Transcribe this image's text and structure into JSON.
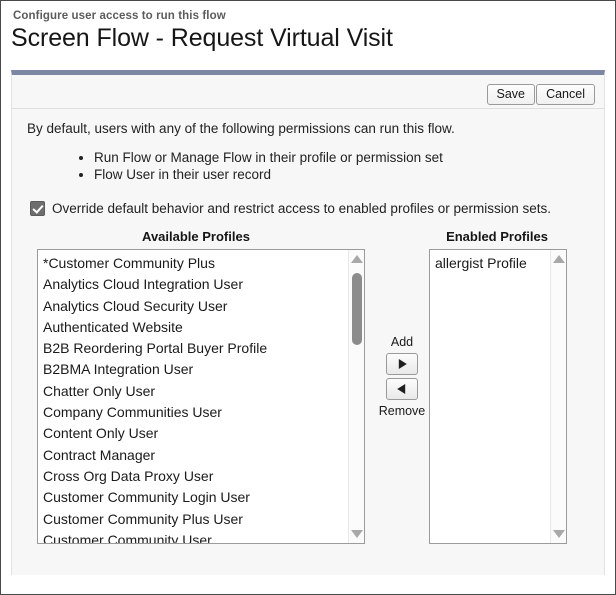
{
  "header": {
    "eyebrow": "Configure user access to run this flow",
    "title": "Screen Flow - Request Virtual Visit"
  },
  "toolbar": {
    "save_label": "Save",
    "cancel_label": "Cancel"
  },
  "body": {
    "intro": "By default, users with any of the following permissions can run this flow.",
    "permissions": [
      "Run Flow or Manage Flow in their profile or permission set",
      "Flow User in their user record"
    ],
    "override": {
      "checked": true,
      "label": "Override default behavior and restrict access to enabled profiles or permission sets."
    }
  },
  "dual_list": {
    "available": {
      "label": "Available Profiles",
      "options": [
        "*Customer Community Plus",
        "Analytics Cloud Integration User",
        "Analytics Cloud Security User",
        "Authenticated Website",
        "B2B Reordering Portal Buyer Profile",
        "B2BMA Integration User",
        "Chatter Only User",
        "Company Communities User",
        "Content Only User",
        "Contract Manager",
        "Cross Org Data Proxy User",
        "Customer Community Login User",
        "Customer Community Plus User",
        "Customer Community User"
      ]
    },
    "enabled": {
      "label": "Enabled Profiles",
      "options": [
        "allergist Profile"
      ]
    },
    "transfer": {
      "add_label": "Add",
      "remove_label": "Remove",
      "add_icon": "arrow-right-icon",
      "remove_icon": "arrow-left-icon"
    }
  },
  "colors": {
    "accent_bar": "#7b87a5",
    "panel_bg": "#f7f7f8",
    "checkbox_fill": "#6e6e6e",
    "text": "#222222"
  }
}
